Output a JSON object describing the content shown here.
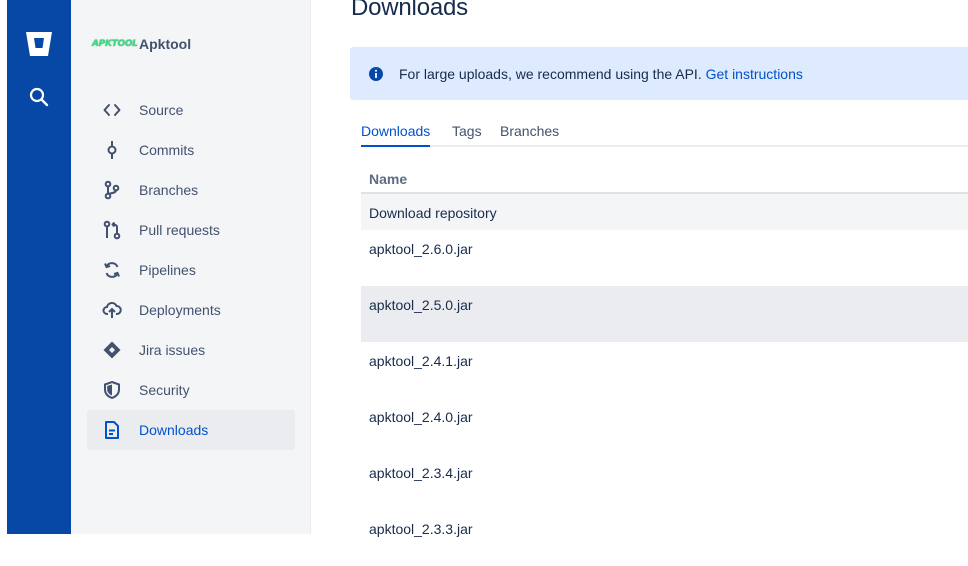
{
  "global_nav": {
    "logo_icon": "bitbucket-logo-icon",
    "search_icon": "search-icon",
    "background": "#0747a6"
  },
  "repo": {
    "logo_text": "APKTOOL",
    "name": "Apktool"
  },
  "sidebar": {
    "items": [
      {
        "label": "Source",
        "icon": "code-icon"
      },
      {
        "label": "Commits",
        "icon": "commit-icon"
      },
      {
        "label": "Branches",
        "icon": "branch-icon"
      },
      {
        "label": "Pull requests",
        "icon": "pull-request-icon"
      },
      {
        "label": "Pipelines",
        "icon": "pipelines-icon"
      },
      {
        "label": "Deployments",
        "icon": "deployments-icon"
      },
      {
        "label": "Jira issues",
        "icon": "jira-icon"
      },
      {
        "label": "Security",
        "icon": "shield-icon"
      },
      {
        "label": "Downloads",
        "icon": "downloads-icon",
        "active": true
      }
    ]
  },
  "main": {
    "title": "Downloads",
    "banner": {
      "text": "For large uploads, we recommend using the API.",
      "link": "Get instructions",
      "icon": "info-icon"
    },
    "tabs": [
      {
        "label": "Downloads",
        "active": true
      },
      {
        "label": "Tags"
      },
      {
        "label": "Branches"
      }
    ],
    "table": {
      "header": "Name",
      "repo_row": "Download repository",
      "files": [
        "apktool_2.6.0.jar",
        "apktool_2.5.0.jar",
        "apktool_2.4.1.jar",
        "apktool_2.4.0.jar",
        "apktool_2.3.4.jar",
        "apktool_2.3.3.jar"
      ]
    }
  },
  "colors": {
    "accent": "#0052cc",
    "banner_bg": "#deebff",
    "sidebar_bg": "#f4f5f7"
  }
}
